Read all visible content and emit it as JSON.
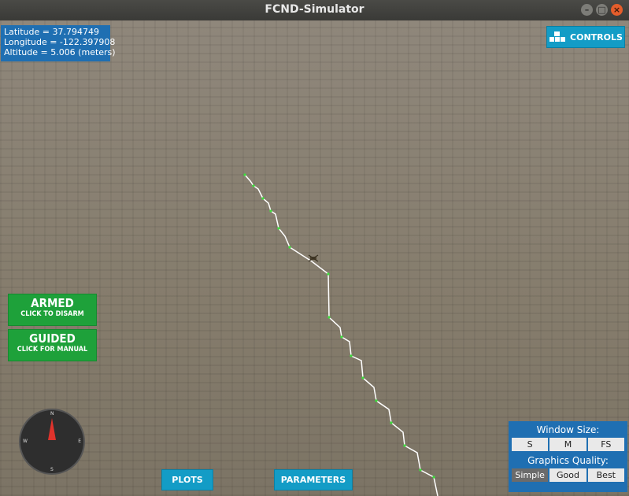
{
  "window": {
    "title": "FCND-Simulator"
  },
  "telemetry": {
    "latitude": "Latitude = 37.794749",
    "longitude": "Longitude = -122.397908",
    "altitude": "Altitude = 5.006 (meters)"
  },
  "controls_button": {
    "label": "CONTROLS",
    "icon": "controls-icon"
  },
  "armed_button": {
    "title": "ARMED",
    "subtitle": "CLICK TO DISARM",
    "color": "#1ea13a"
  },
  "guided_button": {
    "title": "GUIDED",
    "subtitle": "CLICK FOR MANUAL",
    "color": "#1ea13a"
  },
  "compass": {
    "north": "N",
    "south": "S",
    "east": "E",
    "west": "W"
  },
  "bottom_buttons": {
    "plots": "PLOTS",
    "parameters": "PARAMETERS"
  },
  "window_size": {
    "label": "Window Size:",
    "options": [
      "S",
      "M",
      "FS"
    ],
    "selected": ""
  },
  "graphics_quality": {
    "label": "Graphics Quality:",
    "options": [
      "Simple",
      "Good",
      "Best"
    ],
    "selected": "Simple"
  },
  "colors": {
    "panel_blue": "#1f6fb2",
    "button_blue": "#139cc6",
    "path_white": "#ffffff",
    "waypoint_green": "#3ee03e"
  }
}
